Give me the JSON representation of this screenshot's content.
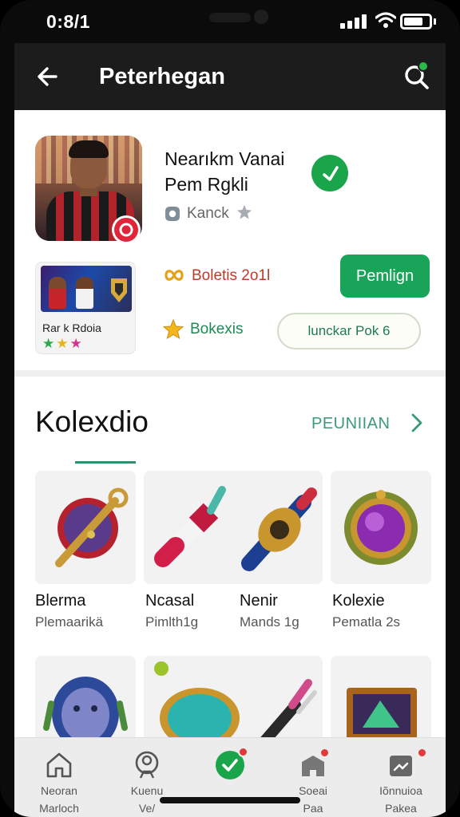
{
  "status_bar": {
    "time": "0:8/1"
  },
  "app_bar": {
    "title": "Peterhegan"
  },
  "profile": {
    "name_line1": "Nearıkm Vanai",
    "name_line2": "Pem Rgkli",
    "rank": "Kanck",
    "card_label": "Rar k Rdoia",
    "card_stars": "★ ★ ★",
    "stat1": "Boletis 2o1l",
    "stat2": "Bokexis",
    "primary_button": "Pemlign",
    "outline_button": "lunckar Pok 6"
  },
  "section": {
    "title": "Kolexdio",
    "see_all": "PEUNIIAN"
  },
  "items": [
    {
      "name": "Blerma",
      "sub": "Plemaarikä"
    },
    {
      "name": "Ncasal",
      "sub": "Pimlth1g"
    },
    {
      "name": "Nenir",
      "sub": "Mands 1g"
    },
    {
      "name": "Kolexie",
      "sub": "Pematla 2s"
    }
  ],
  "nav": [
    {
      "label1": "Neoran",
      "label2": "Marloch"
    },
    {
      "label1": "Kuenu",
      "label2": "Ve/"
    },
    {
      "label1": "",
      "label2": ""
    },
    {
      "label1": "Soeai",
      "label2": "Paa"
    },
    {
      "label1": "Iõnnuioa",
      "label2": "Pakea"
    }
  ],
  "colors": {
    "accent": "#1aa45a",
    "app_bar": "#1c1c1c",
    "badge": "#e03a3a",
    "link": "#3a9a7c"
  }
}
